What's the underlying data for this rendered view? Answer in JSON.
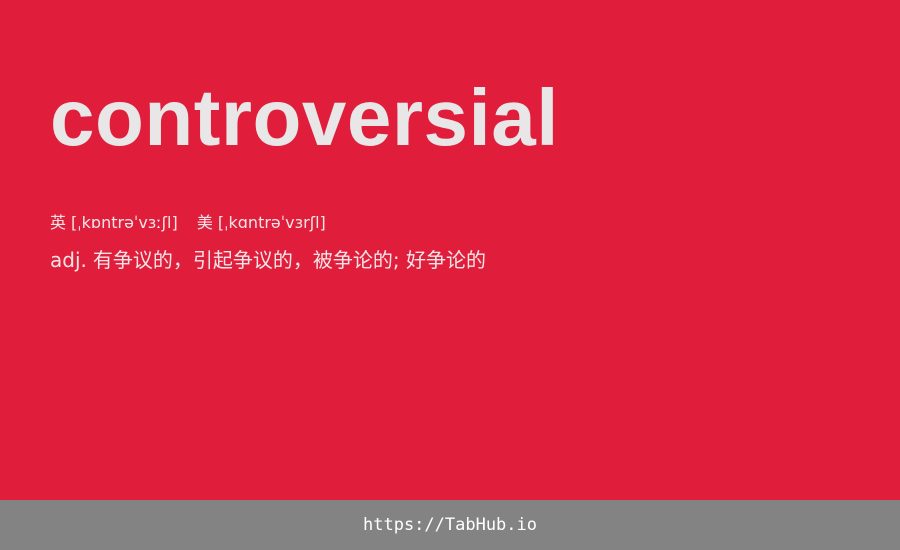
{
  "entry": {
    "word": "controversial",
    "phonetics": {
      "uk_label": "英",
      "uk_ipa": "[ˌkɒntrəˈvɜːʃl]",
      "us_label": "美",
      "us_ipa": "[ˌkɑntrəˈvɜrʃl]"
    },
    "definition": {
      "pos": "adj.",
      "text": "有争议的，引起争议的，被争论的; 好争论的"
    }
  },
  "footer": {
    "link_text": "https://TabHub.io"
  },
  "colors": {
    "background": "#e01e3c",
    "footer_background": "#838383",
    "word_color": "#e8e6e6"
  }
}
